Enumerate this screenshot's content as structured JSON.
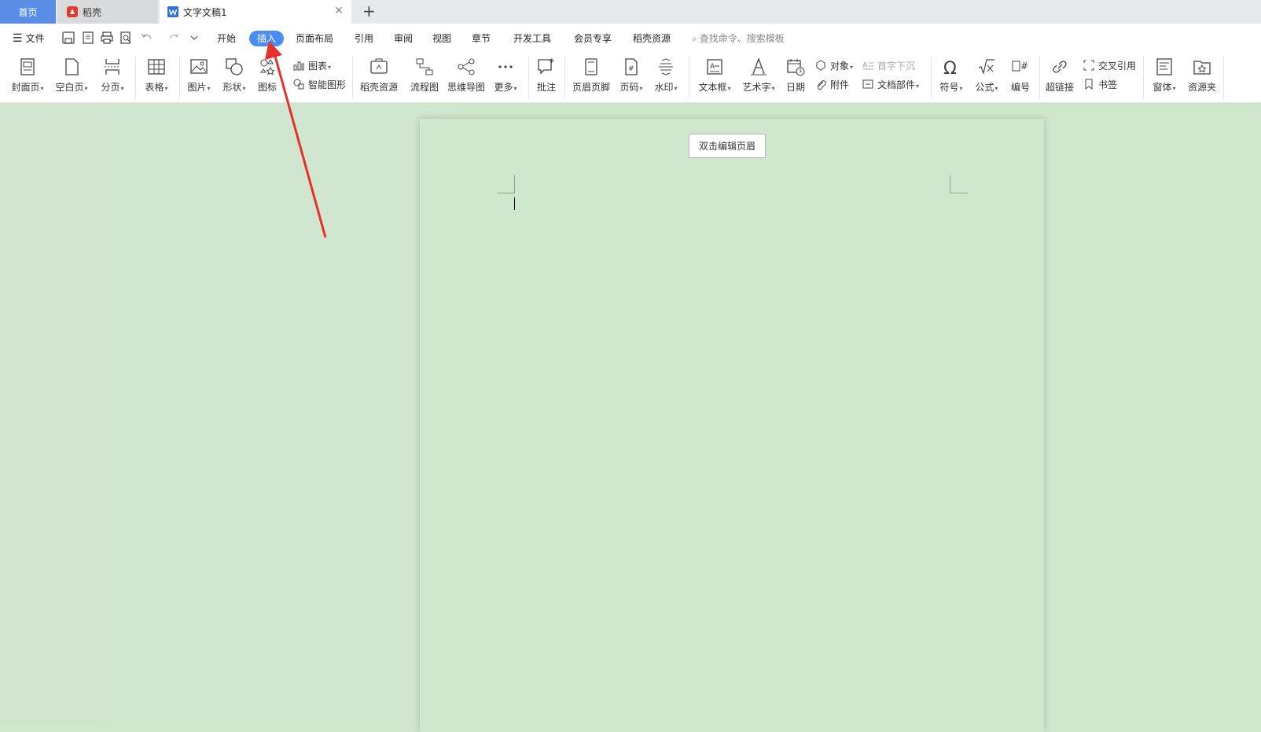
{
  "tabs": {
    "home": "首页",
    "daoke": "稻壳",
    "document": "文字文稿1"
  },
  "menu": {
    "file": "文件",
    "items": [
      "开始",
      "插入",
      "页面布局",
      "引用",
      "审阅",
      "视图",
      "章节",
      "开发工具",
      "会员专享",
      "稻壳资源"
    ],
    "active": "插入",
    "search_placeholder": "查找命令、搜索模板"
  },
  "ribbon": {
    "cover": "封面页",
    "blank": "空白页",
    "pagebreak": "分页",
    "table": "表格",
    "picture": "图片",
    "shape": "形状",
    "icon": "图标",
    "chart": "图表",
    "smartart": "智能图形",
    "daoke_res": "稻壳资源",
    "flowchart": "流程图",
    "mindmap": "思维导图",
    "more": "更多",
    "comment": "批注",
    "headerfooter": "页眉页脚",
    "pagenum": "页码",
    "watermark": "水印",
    "textbox": "文本框",
    "wordart": "艺术字",
    "date": "日期",
    "object": "对象",
    "attachment": "附件",
    "dropcap": "首字下沉",
    "docparts": "文档部件",
    "symbol": "符号",
    "formula": "公式",
    "numbering": "编号",
    "hyperlink": "超链接",
    "crossref": "交叉引用",
    "bookmark": "书签",
    "window": "窗体",
    "resources": "资源夹"
  },
  "document": {
    "header_tip": "双击编辑页眉"
  },
  "colors": {
    "accent": "#4a8df2",
    "arrow": "#e8302a",
    "doc_bg": "#cfe6cd"
  }
}
